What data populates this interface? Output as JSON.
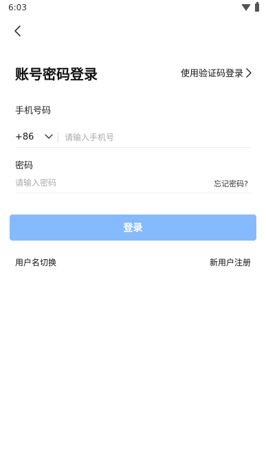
{
  "status_bar": {
    "time": "6:03",
    "icons": [
      "wifi-icon",
      "battery-icon"
    ]
  },
  "header": {
    "back_icon": "chevron-left-icon"
  },
  "title": "账号密码登录",
  "code_login": {
    "label": "使用验证码登录",
    "icon": "chevron-right-icon"
  },
  "phone": {
    "label": "手机号码",
    "country_code": "+86",
    "placeholder": "请输入手机号",
    "value": ""
  },
  "password": {
    "label": "密码",
    "placeholder": "请输入密码",
    "value": "",
    "forgot_label": "忘记密码?"
  },
  "login_button": {
    "label": "登录",
    "color": "#86baff"
  },
  "footer": {
    "switch_user_label": "用户名切换",
    "register_label": "新用户注册"
  }
}
